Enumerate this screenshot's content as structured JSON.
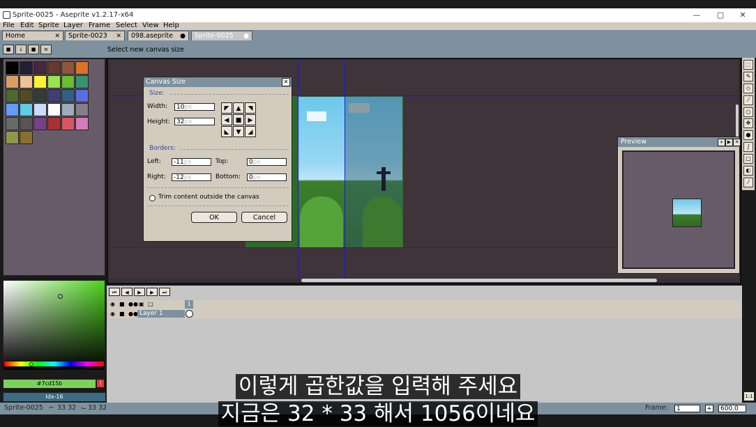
{
  "window": {
    "title": "Sprite-0025 - Aseprite v1.2.17-x64",
    "minimize": "—",
    "maximize": "▢",
    "close": "✕"
  },
  "menu": [
    "File",
    "Edit",
    "Sprite",
    "Layer",
    "Frame",
    "Select",
    "View",
    "Help"
  ],
  "tabs": [
    {
      "label": "Home",
      "mark": "✕"
    },
    {
      "label": "Sprite-0023",
      "mark": "✕"
    },
    {
      "label": "098.aseprite",
      "mark": "●"
    },
    {
      "label": "Sprite-0025",
      "mark": "●"
    }
  ],
  "status_message": "Select new canvas size",
  "palette_colors": [
    "#000000",
    "#222034",
    "#45283c",
    "#663931",
    "#8f563b",
    "#df7126",
    "#d9a066",
    "#eec39a",
    "#fbf236",
    "#99e550",
    "#6abe30",
    "#37946e",
    "#4b692f",
    "#524b24",
    "#323c39",
    "#3f3f74",
    "#306082",
    "#5b6ee1",
    "#639bff",
    "#5fcde4",
    "#cbdbfc",
    "#ffffff",
    "#9badb7",
    "#847e87",
    "#696a6a",
    "#595652",
    "#76428a",
    "#ac3232",
    "#d95763",
    "#d77bba",
    "#8f974a",
    "#8a6f30"
  ],
  "fg_color": {
    "hex": "7cd15b",
    "label": "#7cd15b",
    "warn": "!"
  },
  "index_label": "Idx-16",
  "dialog": {
    "title": "Canvas Size",
    "close": "✕",
    "size_section": "Size:",
    "width_label": "Width:",
    "width_value": "10",
    "height_label": "Height:",
    "height_value": "32",
    "unit": "px",
    "borders_section": "Borders:",
    "left_label": "Left:",
    "left_value": "-11",
    "top_label": "Top:",
    "top_value": "0",
    "right_label": "Right:",
    "right_value": "-12",
    "bottom_label": "Bottom:",
    "bottom_value": "0",
    "trim_label": "Trim content outside the canvas",
    "trim_checked": false,
    "ok_label": "OK",
    "cancel_label": "Cancel",
    "anchors": [
      "◤",
      "▲",
      "◥",
      "◀",
      "■",
      "▶",
      "◣",
      "▼",
      "◢"
    ]
  },
  "preview": {
    "title": "Preview"
  },
  "timeline": {
    "frame_number": "1",
    "layer_name": "Layer 1"
  },
  "bottom": {
    "sprite_name": "Sprite-0025",
    "size_info": "33 32",
    "pos_info": "33 32",
    "frame_label": "Frame:",
    "frame_value": "1",
    "zoom_value": "600.0",
    "zoom_btn": "1:1",
    "plus": "+"
  },
  "subtitles": {
    "line1": "이렇게 곱한값을 입력해 주세요",
    "line2": "지금은 32 * 33 해서 1056이네요"
  }
}
